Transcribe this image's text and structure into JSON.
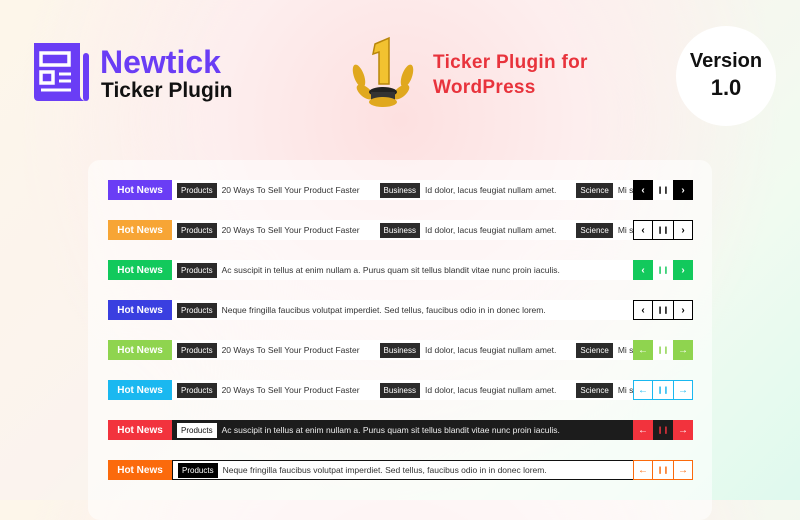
{
  "brand": {
    "name": "Newtick",
    "subtitle": "Ticker Plugin",
    "icon": "newspaper-icon",
    "color": "#6a3df5"
  },
  "tagline": {
    "line1": "Ticker Plugin for",
    "line2": "WordPress",
    "icon": "trophy-number-one-icon"
  },
  "version": {
    "label": "Version",
    "number": "1.0"
  },
  "tickers": [
    {
      "label": "Hot News",
      "color": "#6a3df5",
      "variant": "multi",
      "controls": "dark",
      "body": "light",
      "arrows": "chevron",
      "items": [
        {
          "cat": "Products",
          "text": "20 Ways To Sell Your Product Faster"
        },
        {
          "cat": "Business",
          "text": "Id dolor, lacus feugiat nullam amet."
        },
        {
          "cat": "Science",
          "text": "Mi s"
        }
      ]
    },
    {
      "label": "Hot News",
      "color": "#f7a535",
      "variant": "multi",
      "controls": "outline-dark",
      "body": "light",
      "arrows": "chevron",
      "items": [
        {
          "cat": "Products",
          "text": "20 Ways To Sell Your Product Faster"
        },
        {
          "cat": "Business",
          "text": "Id dolor, lacus feugiat nullam amet."
        },
        {
          "cat": "Science",
          "text": "Mi s"
        }
      ]
    },
    {
      "label": "Hot News",
      "color": "#12c95c",
      "variant": "single",
      "controls": "filled",
      "body": "light",
      "arrows": "chevron",
      "items": [
        {
          "cat": "Products",
          "text": "Ac suscipit in tellus at enim nullam a. Purus quam sit tellus blandit vitae nunc proin iaculis."
        }
      ]
    },
    {
      "label": "Hot News",
      "color": "#3a3fe0",
      "variant": "single",
      "controls": "outline-dark",
      "body": "light",
      "arrows": "chevron",
      "items": [
        {
          "cat": "Products",
          "text": "Neque fringilla faucibus volutpat imperdiet. Sed tellus, faucibus odio in in donec lorem."
        }
      ]
    },
    {
      "label": "Hot News",
      "color": "#8fd44f",
      "variant": "multi",
      "controls": "filled",
      "body": "light",
      "arrows": "arrow",
      "items": [
        {
          "cat": "Products",
          "text": "20 Ways To Sell Your Product Faster"
        },
        {
          "cat": "Business",
          "text": "Id dolor, lacus feugiat nullam amet."
        },
        {
          "cat": "Science",
          "text": "Mi s"
        }
      ]
    },
    {
      "label": "Hot News",
      "color": "#1ab8f0",
      "variant": "multi",
      "controls": "outline",
      "body": "light",
      "arrows": "arrow",
      "items": [
        {
          "cat": "Products",
          "text": "20 Ways To Sell Your Product Faster"
        },
        {
          "cat": "Business",
          "text": "Id dolor, lacus feugiat nullam amet."
        },
        {
          "cat": "Science",
          "text": "Mi s"
        }
      ]
    },
    {
      "label": "Hot News",
      "color": "#f2333d",
      "variant": "single",
      "controls": "filled-dark",
      "body": "dark",
      "arrows": "arrow",
      "items": [
        {
          "cat": "Products",
          "text": "Ac suscipit in tellus at enim nullam a. Purus quam sit tellus blandit vitae nunc proin iaculis."
        }
      ]
    },
    {
      "label": "Hot News",
      "color": "#fb6a0c",
      "variant": "single",
      "controls": "outline",
      "body": "outlined",
      "arrows": "arrow",
      "items": [
        {
          "cat": "Products",
          "text": "Neque fringilla faucibus volutpat imperdiet. Sed tellus, faucibus odio in in donec lorem."
        }
      ]
    }
  ]
}
